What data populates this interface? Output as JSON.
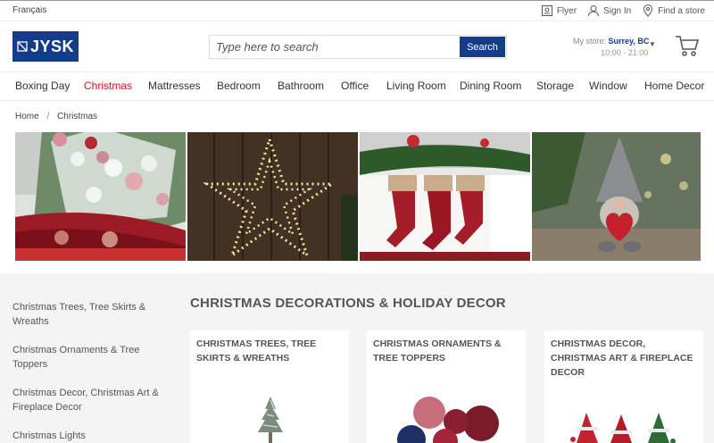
{
  "topbar": {
    "language": "Français",
    "links": [
      {
        "label": "Flyer",
        "icon": "flyer-icon"
      },
      {
        "label": "Sign In",
        "icon": "user-icon"
      },
      {
        "label": "Find a store",
        "icon": "location-pin-icon"
      }
    ]
  },
  "header": {
    "logo_text": "JYSK",
    "search_placeholder": "Type here to search",
    "search_button": "Search",
    "store_label": "My store:",
    "store_name": "Surrey, BC",
    "store_hours": "10:00 - 21:00"
  },
  "nav": [
    "Boxing Day",
    "Christmas",
    "Mattresses",
    "Bedroom",
    "Bathroom",
    "Office",
    "Living Room",
    "Dining Room",
    "Storage",
    "Window",
    "Home Decor"
  ],
  "breadcrumb": {
    "home": "Home",
    "separator": "/",
    "current": "Christmas"
  },
  "hero_images": [
    "christmas-tree-image",
    "star-lights-image",
    "stockings-image",
    "gnome-image"
  ],
  "sidebar": [
    "Christmas Trees, Tree Skirts & Wreaths",
    "Christmas Ornaments & Tree Toppers",
    "Christmas Decor, Christmas Art & Fireplace Decor",
    "Christmas Lights"
  ],
  "main": {
    "title": "CHRISTMAS DECORATIONS & HOLIDAY DECOR",
    "cards": [
      {
        "title": "CHRISTMAS TREES, TREE SKIRTS & WREATHS"
      },
      {
        "title": "CHRISTMAS ORNAMENTS & TREE TOPPERS"
      },
      {
        "title": "CHRISTMAS DECOR, CHRISTMAS ART & FIREPLACE DECOR"
      }
    ]
  },
  "colors": {
    "brand": "#143c8a",
    "christmas": "#c9293b",
    "section_bg": "#f4f4f4"
  }
}
